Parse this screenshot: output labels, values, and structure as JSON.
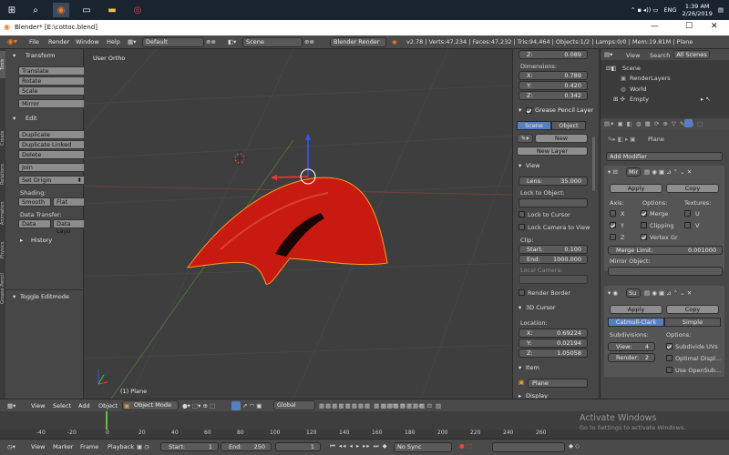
{
  "taskbar": {
    "icons": [
      "windows-start-icon",
      "search-icon",
      "task-view-icon",
      "blender-app-icon",
      "explorer-icon",
      "file-explorer-icon",
      "chrome-icon"
    ],
    "tray": {
      "lang": "ENG",
      "time": "1:39 AM",
      "date": "2/26/2019"
    }
  },
  "window": {
    "title": "Blender* [E:\\cottoc.blend]",
    "min": "—",
    "max": "☐",
    "close": "✕"
  },
  "infobar": {
    "menus": [
      "File",
      "Render",
      "Window",
      "Help"
    ],
    "layout": "Default",
    "scene": "Scene",
    "engine": "Blender Render",
    "stats": "v2.78 | Verts:47,234 | Faces:47,232 | Tris:94,464 | Objects:1/2 | Lamps:0/0 | Mem:19.81M | Plane"
  },
  "tabs": [
    "Tools",
    "Create",
    "Relations",
    "Animation",
    "Physics",
    "Grease Pencil"
  ],
  "toolshelf": {
    "transform_header": "Transform",
    "translate": "Translate",
    "rotate": "Rotate",
    "scale": "Scale",
    "mirror": "Mirror",
    "edit_header": "Edit",
    "duplicate": "Duplicate",
    "duplicate_linked": "Duplicate Linked",
    "delete": "Delete",
    "join": "Join",
    "set_origin": "Set Origin",
    "shading": "Shading:",
    "smooth": "Smooth",
    "flat": "Flat",
    "data_transfer": "Data Transfer:",
    "data": "Data",
    "data_layo": "Data Layo",
    "history": "History",
    "toggle_editmode": "Toggle Editmode"
  },
  "viewport": {
    "label": "User Ortho",
    "object_label": "(1) Plane"
  },
  "npanel": {
    "z_top": "0.089",
    "dimensions": "Dimensions:",
    "dims": [
      [
        "X:",
        "0.789"
      ],
      [
        "Y:",
        "0.420"
      ],
      [
        "Z:",
        "0.342"
      ]
    ],
    "grease_header": "Grease Pencil Layer",
    "scene_tab": "Scene",
    "object_tab": "Object",
    "new": "New",
    "new_layer": "New Layer",
    "view_header": "View",
    "lens_k": "Lens:",
    "lens_v": "35.000",
    "lock_to_object": "Lock to Object:",
    "lock_to_cursor": "Lock to Cursor",
    "lock_camera": "Lock Camera to View",
    "clip": "Clip:",
    "clip_start_k": "Start:",
    "clip_start_v": "0.100",
    "clip_end_k": "End:",
    "clip_end_v": "1000.000",
    "local_camera": "Local Camera:",
    "render_border": "Render Border",
    "cursor_header": "3D Cursor",
    "location": "Location:",
    "loc": [
      [
        "X:",
        "0.69224"
      ],
      [
        "Y:",
        "0.02194"
      ],
      [
        "Z:",
        "1.05058"
      ]
    ],
    "item_header": "Item",
    "item_name": "Plane",
    "display_header": "Display"
  },
  "outliner": {
    "view": "View",
    "search": "Search",
    "all_scenes": "All Scenes",
    "items": [
      "Scene",
      "RenderLayers",
      "World",
      "Empty"
    ]
  },
  "props": {
    "breadcrumb": "Plane",
    "add_modifier": "Add Modifier",
    "mod1": {
      "name": "Mir",
      "apply": "Apply",
      "copy": "Copy",
      "axis": "Axis:",
      "options": "Options:",
      "textures": "Textures:",
      "x": "X",
      "y": "Y",
      "z": "Z",
      "merge": "Merge",
      "clipping": "Clipping",
      "vertex_gr": "Vertex Gr",
      "u": "U",
      "v": "V",
      "merge_limit_k": "Merge Limit:",
      "merge_limit_v": "0.001000",
      "mirror_object": "Mirror Object:"
    },
    "mod2": {
      "name": "Su",
      "apply": "Apply",
      "copy": "Copy",
      "catmull": "Catmull-Clark",
      "simple": "Simple",
      "subdivisions": "Subdivisions:",
      "options": "Options:",
      "view_k": "View:",
      "view_v": "4",
      "render_k": "Render:",
      "render_v": "2",
      "subdivide_uvs": "Subdivide UVs",
      "optimal": "Optimal Displ...",
      "use_opensub": "Use OpenSub..."
    }
  },
  "vpheader": {
    "view": "View",
    "select": "Select",
    "add": "Add",
    "object": "Object",
    "mode": "Object Mode",
    "orientation": "Global"
  },
  "timeline": {
    "ticks": [
      "-40",
      "-20",
      "0",
      "20",
      "40",
      "60",
      "80",
      "100",
      "120",
      "140",
      "160",
      "180",
      "200",
      "220",
      "240",
      "260"
    ],
    "watermark_title": "Activate Windows",
    "watermark_sub": "Go to Settings to activate Windows."
  },
  "tlheader": {
    "view": "View",
    "marker": "Marker",
    "frame": "Frame",
    "playback": "Playback",
    "start_k": "Start:",
    "start_v": "1",
    "end_k": "End:",
    "end_v": "250",
    "current": "1",
    "sync": "No Sync"
  },
  "colors": {
    "accent": "#5680c2",
    "mesh": "#c81a10",
    "outline": "#ff9a1c"
  }
}
